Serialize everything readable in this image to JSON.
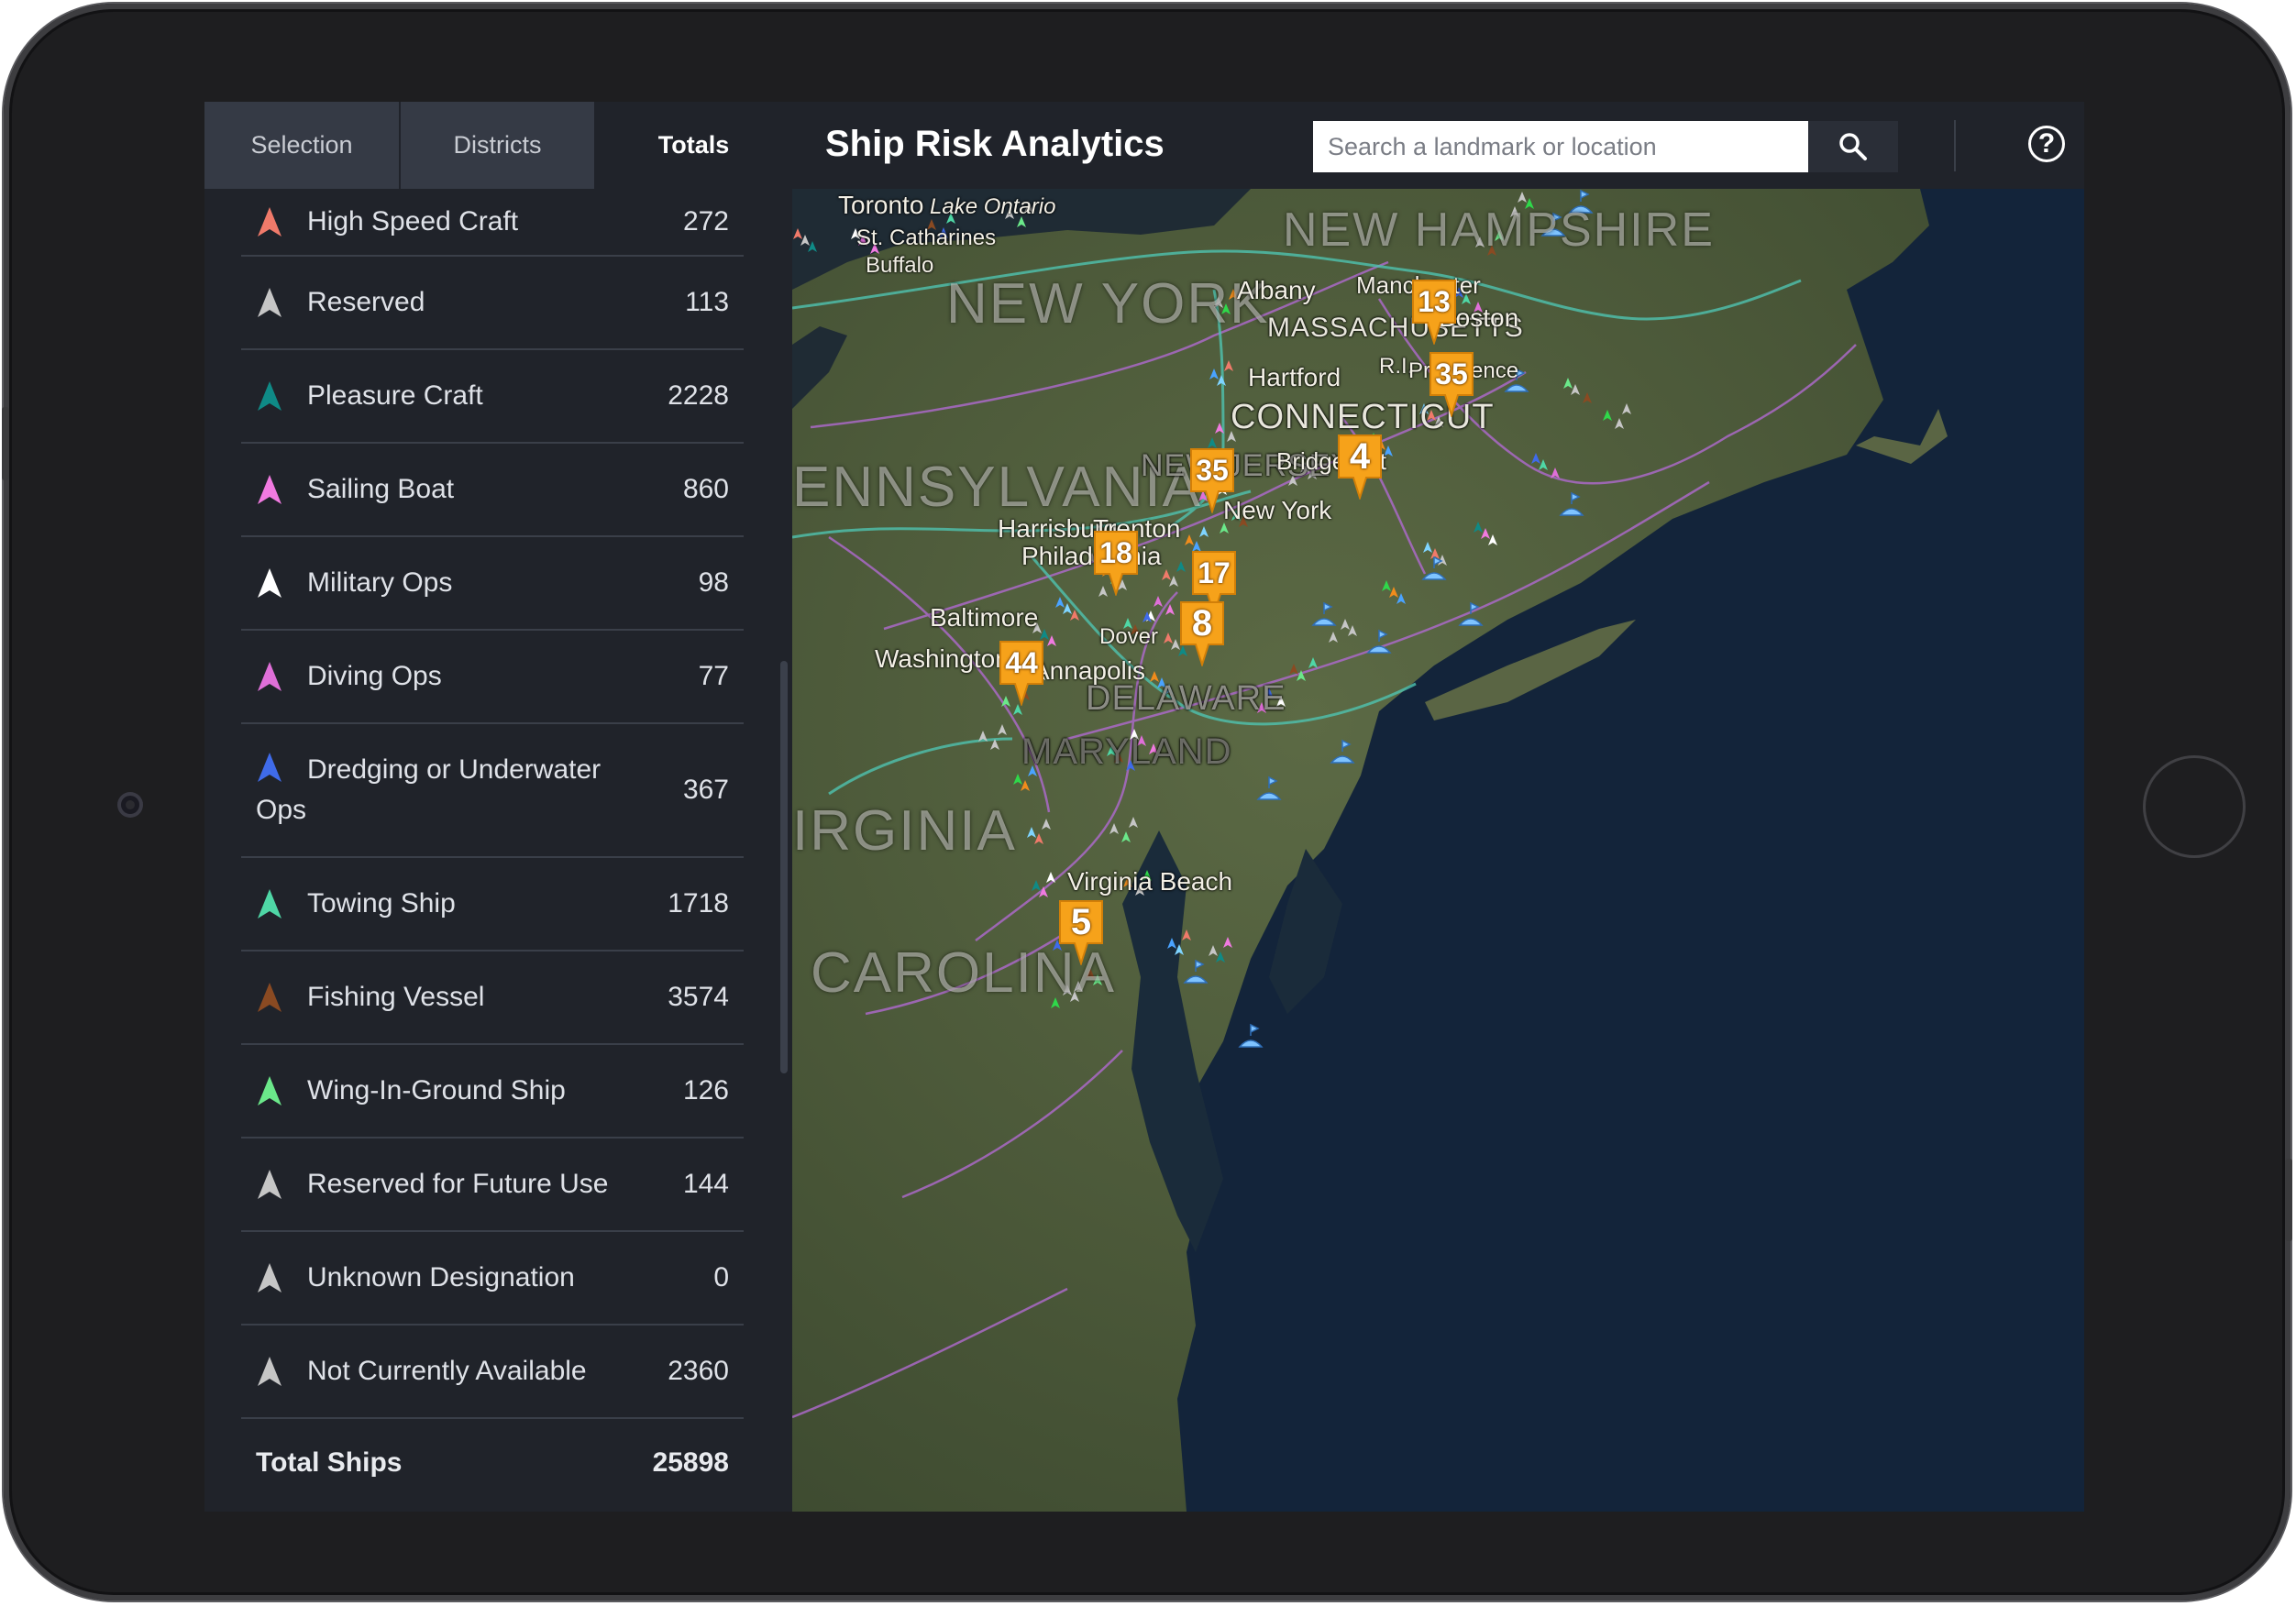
{
  "tabs": [
    {
      "label": "Selection",
      "active": false
    },
    {
      "label": "Districts",
      "active": false
    },
    {
      "label": "Totals",
      "active": true
    }
  ],
  "totals": [
    {
      "label": "High Speed Craft",
      "value": "272",
      "color": "#f07a6a"
    },
    {
      "label": "Reserved",
      "value": "113",
      "color": "#c6c6c6"
    },
    {
      "label": "Pleasure Craft",
      "value": "2228",
      "color": "#0f8a86"
    },
    {
      "label": "Sailing Boat",
      "value": "860",
      "color": "#f07ae0"
    },
    {
      "label": "Military Ops",
      "value": "98",
      "color": "#ffffff"
    },
    {
      "label": "Diving Ops",
      "value": "77",
      "color": "#df6fd8"
    },
    {
      "label": "Dredging or Underwater Ops",
      "value": "367",
      "color": "#3f6bea"
    },
    {
      "label": "Towing Ship",
      "value": "1718",
      "color": "#4fd7a6"
    },
    {
      "label": "Fishing Vessel",
      "value": "3574",
      "color": "#8a4a22"
    },
    {
      "label": "Wing-In-Ground Ship",
      "value": "126",
      "color": "#6be88a"
    },
    {
      "label": "Reserved for Future Use",
      "value": "144",
      "color": "#c6c6c6"
    },
    {
      "label": "Unknown Designation",
      "value": "0",
      "color": "#c6c6c6"
    },
    {
      "label": "Not Currently Available",
      "value": "2360",
      "color": "#c6c6c6"
    }
  ],
  "total_ships": {
    "label": "Total Ships",
    "value": "25898"
  },
  "header": {
    "title": "Ship Risk Analytics",
    "search_placeholder": "Search a landmark or location"
  },
  "map": {
    "states": [
      "NEW YORK",
      "ENNSYLVANIA",
      "NEW HAMPSHIRE",
      "MASSACHUSETTS",
      "CONNECTICUT",
      "NEW JERSEY",
      "DELAWARE",
      "MARYLAND",
      "IRGINIA",
      "CAROLINA",
      "R.I."
    ],
    "cities": [
      "Toronto",
      "Lake Ontario",
      "St. Catharines",
      "Buffalo",
      "Albany",
      "Manchester",
      "Boston",
      "Hartford",
      "Providence",
      "Bridgeport",
      "New York",
      "Harrisburg",
      "Trenton",
      "Philadelphia",
      "Baltimore",
      "Washington",
      "Annapolis",
      "Dover",
      "Virginia Beach"
    ],
    "clusters": [
      "13",
      "35",
      "4",
      "35",
      "18",
      "17",
      "8",
      "44",
      "5"
    ],
    "cluster_color": "#f6a21a"
  }
}
